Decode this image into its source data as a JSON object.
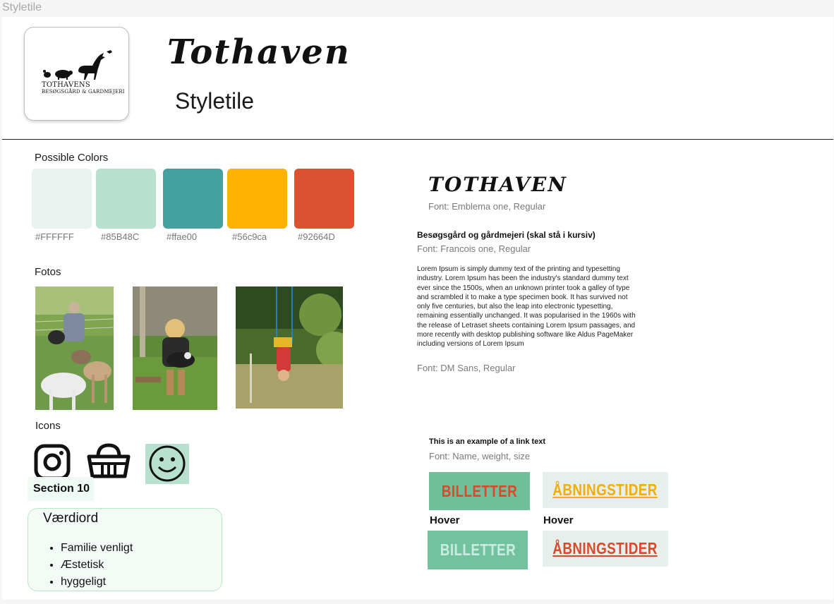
{
  "frame": {
    "label": "Styletile"
  },
  "header": {
    "logo_line1": "TOTHAVENS",
    "logo_line2": "BESØGSGÅRD & GARDMEJERI",
    "title": "Tothaven",
    "subtitle": "Styletile"
  },
  "colors": {
    "label": "Possible Colors",
    "swatches": [
      {
        "hex_label": "#FFFFFF",
        "fill": "#e9f2ee"
      },
      {
        "hex_label": "#85B48C",
        "fill": "#b8e0cf"
      },
      {
        "hex_label": "#ffae00",
        "fill": "#45a1a0"
      },
      {
        "hex_label": "#56c9ca",
        "fill": "#ffb300"
      },
      {
        "hex_label": "#92664D",
        "fill": "#dc5130"
      }
    ]
  },
  "fotos": {
    "label": "Fotos"
  },
  "icons": {
    "label": "Icons",
    "items": [
      "instagram-icon",
      "basket-icon",
      "smiley-icon"
    ]
  },
  "section10": {
    "label": "Section 10"
  },
  "values": {
    "title": "Værdiord",
    "items": [
      "Familie venligt",
      "Æstetisk",
      "hyggeligt"
    ]
  },
  "typography": {
    "display_sample": "TOTHAVEN",
    "display_font": "Font: Emblema one, Regular",
    "sub_sample": "Besøgsgård og gårdmejeri (skal stå i kursiv)",
    "sub_font": "Font: Francois one, Regular",
    "body_sample": "Lorem Ipsum is simply dummy text of the printing and typesetting industry. Lorem Ipsum has been the industry's standard dummy text ever since the 1500s, when an unknown printer took a galley of type and scrambled it to make a type specimen book. It has survived not only five centuries, but also the leap into electronic typesetting, remaining essentially unchanged. It was popularised in the 1960s with the release of Letraset sheets containing Lorem Ipsum passages, and more recently with desktop publishing software like Aldus PageMaker including versions of Lorem Ipsum",
    "body_font": "Font: DM Sans, Regular",
    "link_sample": "This is an example of a link text",
    "link_font": "Font: Name, weight, size"
  },
  "buttons": {
    "billetter": "BILLETTER",
    "aabningstider": "ÅBNINGSTIDER",
    "hover_label": "Hover",
    "colors": {
      "billetter_bg": "#6fbf9a",
      "billetter_fg": "#d9492b",
      "billetter_hover_bg": "#72c2a0",
      "billetter_hover_fg": "#c9ece0",
      "aabning_bg": "#e6efec",
      "aabning_fg": "#f3ad07",
      "aabning_hover_bg": "#e6efec",
      "aabning_hover_fg": "#d9492b"
    }
  }
}
